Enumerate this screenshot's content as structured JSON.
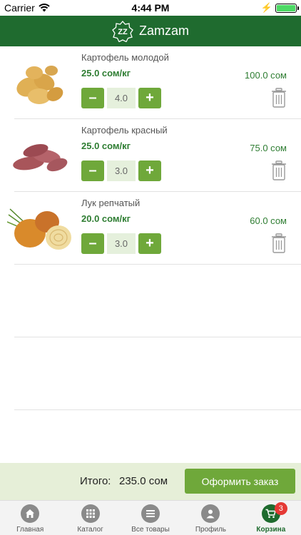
{
  "status_bar": {
    "carrier": "Carrier",
    "time": "4:44 PM"
  },
  "header": {
    "brand": "Zamzam",
    "brand_color": "#1f6b2f"
  },
  "cart": {
    "items": [
      {
        "name": "Картофель молодой",
        "unit_price": "25.0 сом/кг",
        "total": "100.0 сом",
        "quantity": "4.0",
        "image": "young-potatoes"
      },
      {
        "name": "Картофель красный",
        "unit_price": "25.0 сом/кг",
        "total": "75.0 сом",
        "quantity": "3.0",
        "image": "red-potatoes"
      },
      {
        "name": "Лук репчатый",
        "unit_price": "20.0 сом/кг",
        "total": "60.0 сом",
        "quantity": "3.0",
        "image": "onions"
      }
    ],
    "minus_label": "–",
    "plus_label": "+"
  },
  "summary": {
    "total_label": "Итого:",
    "total_value": "235.0 сом",
    "checkout_label": "Оформить заказ"
  },
  "tabs": [
    {
      "label": "Главная",
      "icon": "home-icon"
    },
    {
      "label": "Каталог",
      "icon": "grid-icon"
    },
    {
      "label": "Все товары",
      "icon": "list-icon"
    },
    {
      "label": "Профиль",
      "icon": "user-icon"
    },
    {
      "label": "Корзина",
      "icon": "cart-icon",
      "badge": "3",
      "active": true
    }
  ],
  "colors": {
    "accent": "#6fa83a",
    "price": "#2e7d32",
    "footer_bg": "#e6efd8",
    "badge": "#e53935"
  }
}
